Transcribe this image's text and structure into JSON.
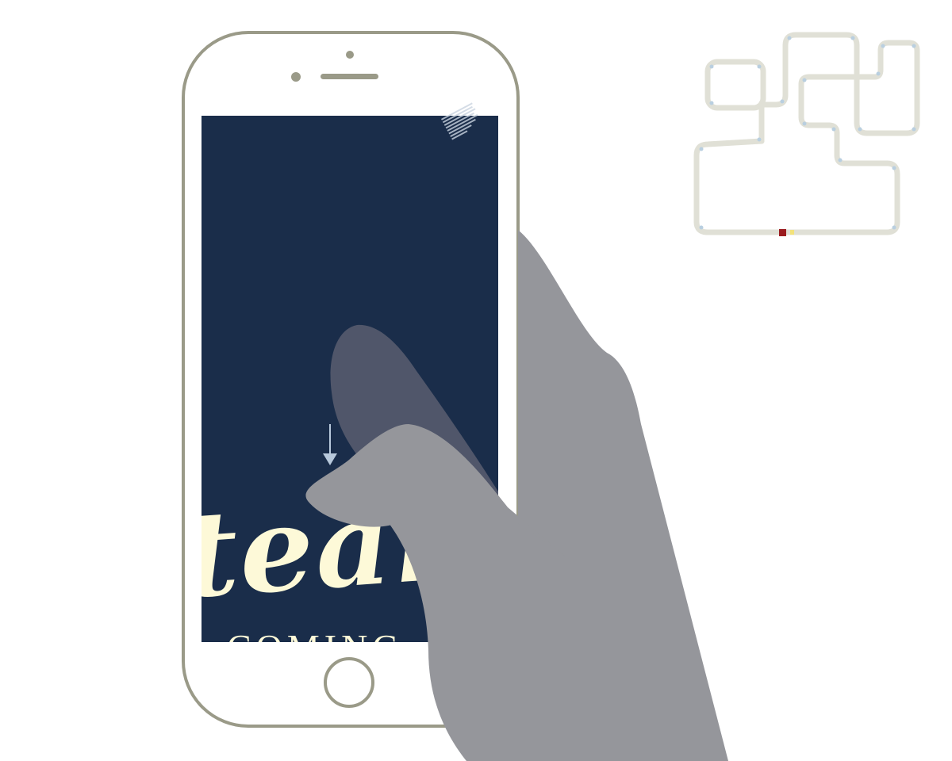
{
  "screen": {
    "headline_script": "team",
    "subline": "COMING",
    "scroll_hint_icon": "arrow-down-icon",
    "corner_fine_print_lines": [
      "",
      "",
      "",
      "",
      "",
      "",
      "",
      ""
    ]
  },
  "colors": {
    "phone_outline": "#9a9a88",
    "screen_bg": "#1a2d4a",
    "script_text": "#fdf9d8",
    "arrow": "#b8c9dc",
    "hand": "#95969b",
    "thumb_over_screen": "#50566a",
    "track": "#e0e0d6",
    "track_node": "#b9cfe0",
    "marker_red": "#9b1c20",
    "marker_yellow": "#f3e27a"
  },
  "track_map": {
    "icon": "track-layout-icon",
    "markers": [
      "red-train-marker",
      "yellow-train-marker"
    ]
  }
}
